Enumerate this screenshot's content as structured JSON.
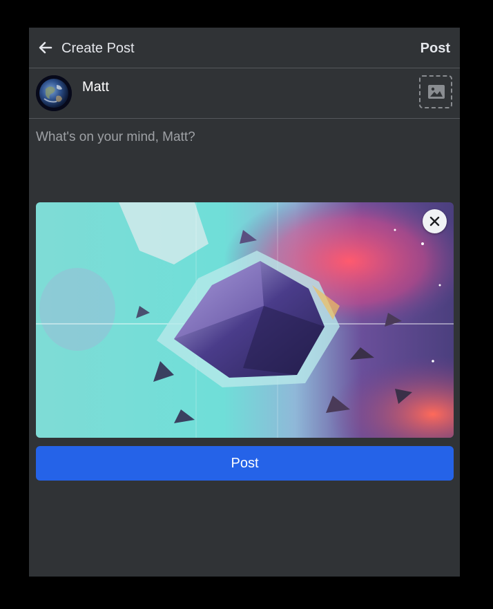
{
  "header": {
    "back_icon": "arrow-left-icon",
    "title": "Create Post",
    "post_label": "Post"
  },
  "user": {
    "name": "Matt",
    "avatar": "earth-avatar"
  },
  "composer": {
    "placeholder": "What's on your mind, Matt?"
  },
  "attachment": {
    "image": "abstract-crystal-artwork",
    "remove_icon": "close-icon"
  },
  "add_photo_icon": "image-icon",
  "submit": {
    "label": "Post",
    "color": "#2563e8"
  },
  "colors": {
    "panel": "#303336",
    "background": "#000000",
    "divider": "#55585c"
  }
}
